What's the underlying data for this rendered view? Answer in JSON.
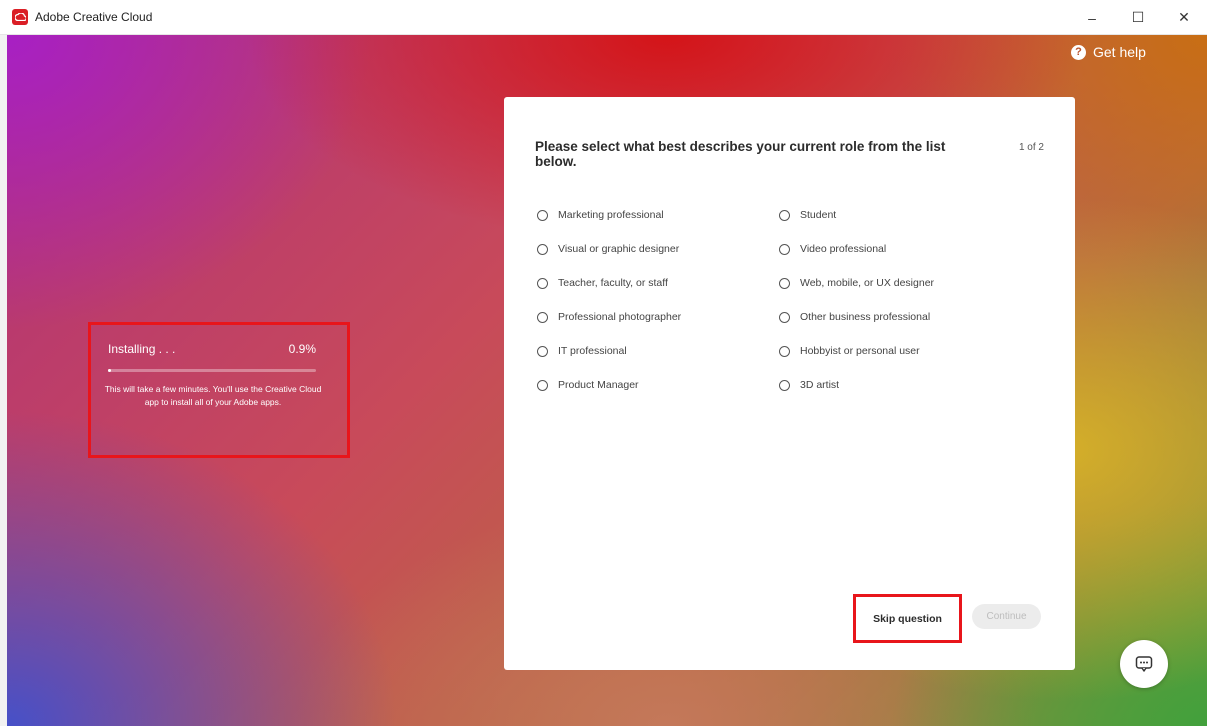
{
  "window": {
    "title": "Adobe Creative Cloud",
    "controls": {
      "minimize": "–",
      "maximize": "☐",
      "close": "✕"
    }
  },
  "header": {
    "help_label": "Get help",
    "help_icon_glyph": "?"
  },
  "install": {
    "status_label": "Installing . . .",
    "percent_label": "0.9%",
    "progress_fraction": 0.009,
    "message": "This will take a few minutes. You'll use the Creative Cloud app to install all of your Adobe apps."
  },
  "survey": {
    "question": "Please select what best describes your current role from the list below.",
    "step": "1 of 2",
    "options_left": [
      "Marketing professional",
      "Visual or graphic designer",
      "Teacher, faculty, or staff",
      "Professional photographer",
      "IT professional",
      "Product Manager"
    ],
    "options_right": [
      "Student",
      "Video professional",
      "Web, mobile, or UX designer",
      "Other business professional",
      "Hobbyist or personal user",
      "3D artist"
    ],
    "skip_label": "Skip question",
    "continue_label": "Continue"
  },
  "colors": {
    "highlight_border": "#e8151b",
    "adobe_red": "#da1f26"
  },
  "icons": {
    "app_logo": "creative-cloud-icon",
    "help": "help-circle-icon",
    "chat": "chat-icon"
  }
}
